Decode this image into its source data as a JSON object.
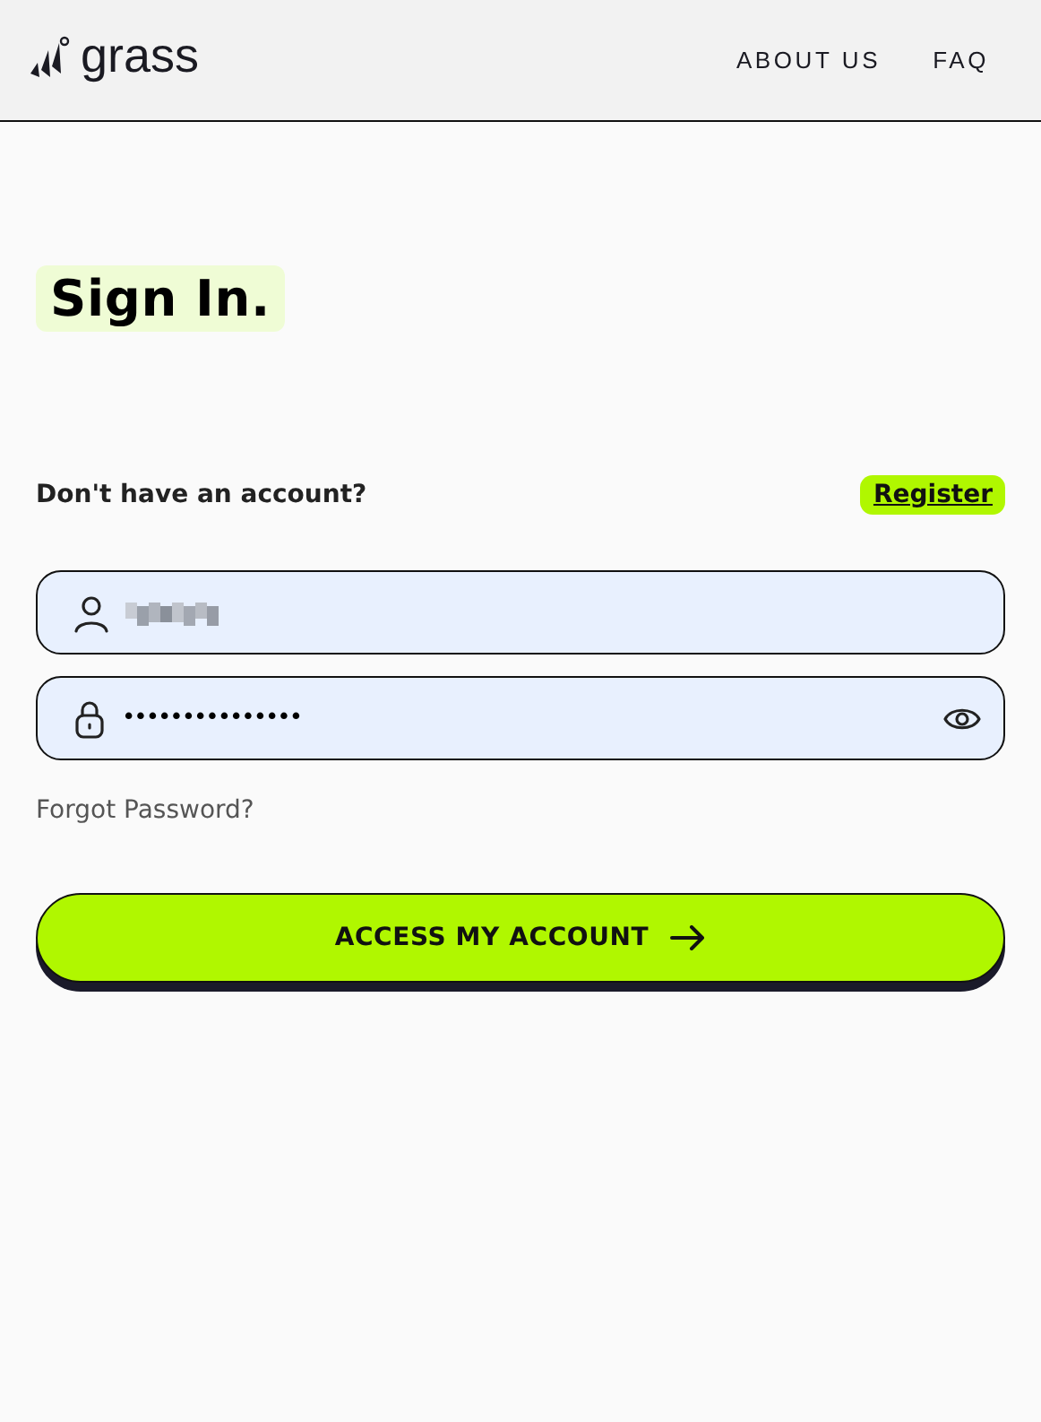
{
  "header": {
    "logo_text": "grass",
    "nav": [
      "ABOUT US",
      "FAQ"
    ]
  },
  "title": "Sign In.",
  "register_prompt": {
    "text": "Don't have an account?",
    "link": "Register"
  },
  "username_field": {
    "blurred": true
  },
  "password_field": {
    "value": "•••••••••••••••"
  },
  "forgot_link": "Forgot Password?",
  "submit_button": "ACCESS MY ACCOUNT"
}
